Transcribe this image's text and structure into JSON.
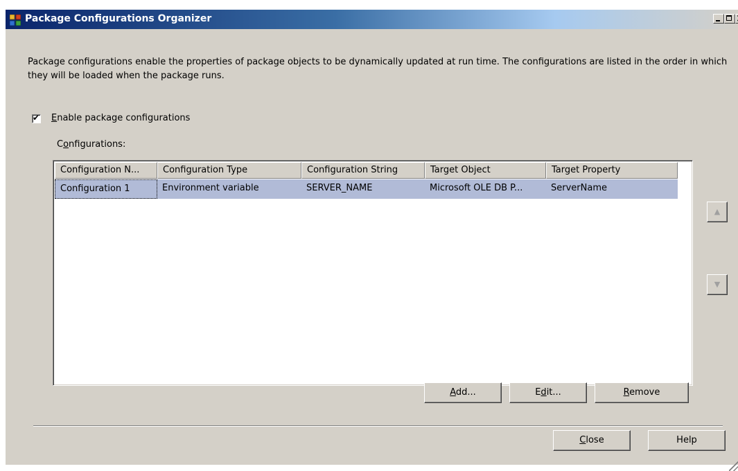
{
  "window": {
    "title": "Package Configurations Organizer"
  },
  "description": "Package configurations enable the properties of package objects to be dynamically updated at run time. The configurations are listed in the order in which they will be loaded when the package runs.",
  "enable_checkbox": {
    "checked": true,
    "label_mnemonic": "E",
    "label_rest": "nable package configurations"
  },
  "configurations_label": {
    "before": "C",
    "mnemonic": "o",
    "after": "nfigurations:"
  },
  "table": {
    "columns": [
      "Configuration N...",
      "Configuration Type",
      "Configuration String",
      "Target Object",
      "Target Property"
    ],
    "rows": [
      [
        "Configuration 1",
        "Environment variable",
        "SERVER_NAME",
        "Microsoft OLE DB P...",
        "ServerName"
      ]
    ],
    "selected_row": 0
  },
  "side_buttons": {
    "up_icon": "arrow-up-icon",
    "down_icon": "arrow-down-icon",
    "up_glyph": "▲",
    "down_glyph": "▼"
  },
  "buttons": {
    "add": {
      "mnemonic": "A",
      "rest": "dd..."
    },
    "edit": {
      "before": "E",
      "mnemonic": "d",
      "after": "it..."
    },
    "remove": {
      "mnemonic": "R",
      "rest": "emove"
    },
    "close": {
      "mnemonic": "C",
      "rest": "lose"
    },
    "help": {
      "label": "Help"
    }
  },
  "colors": {
    "title_bar_start": "#0a246a",
    "dialog_bg": "#d4d0c8",
    "selected_row": "#b1bbd7"
  }
}
